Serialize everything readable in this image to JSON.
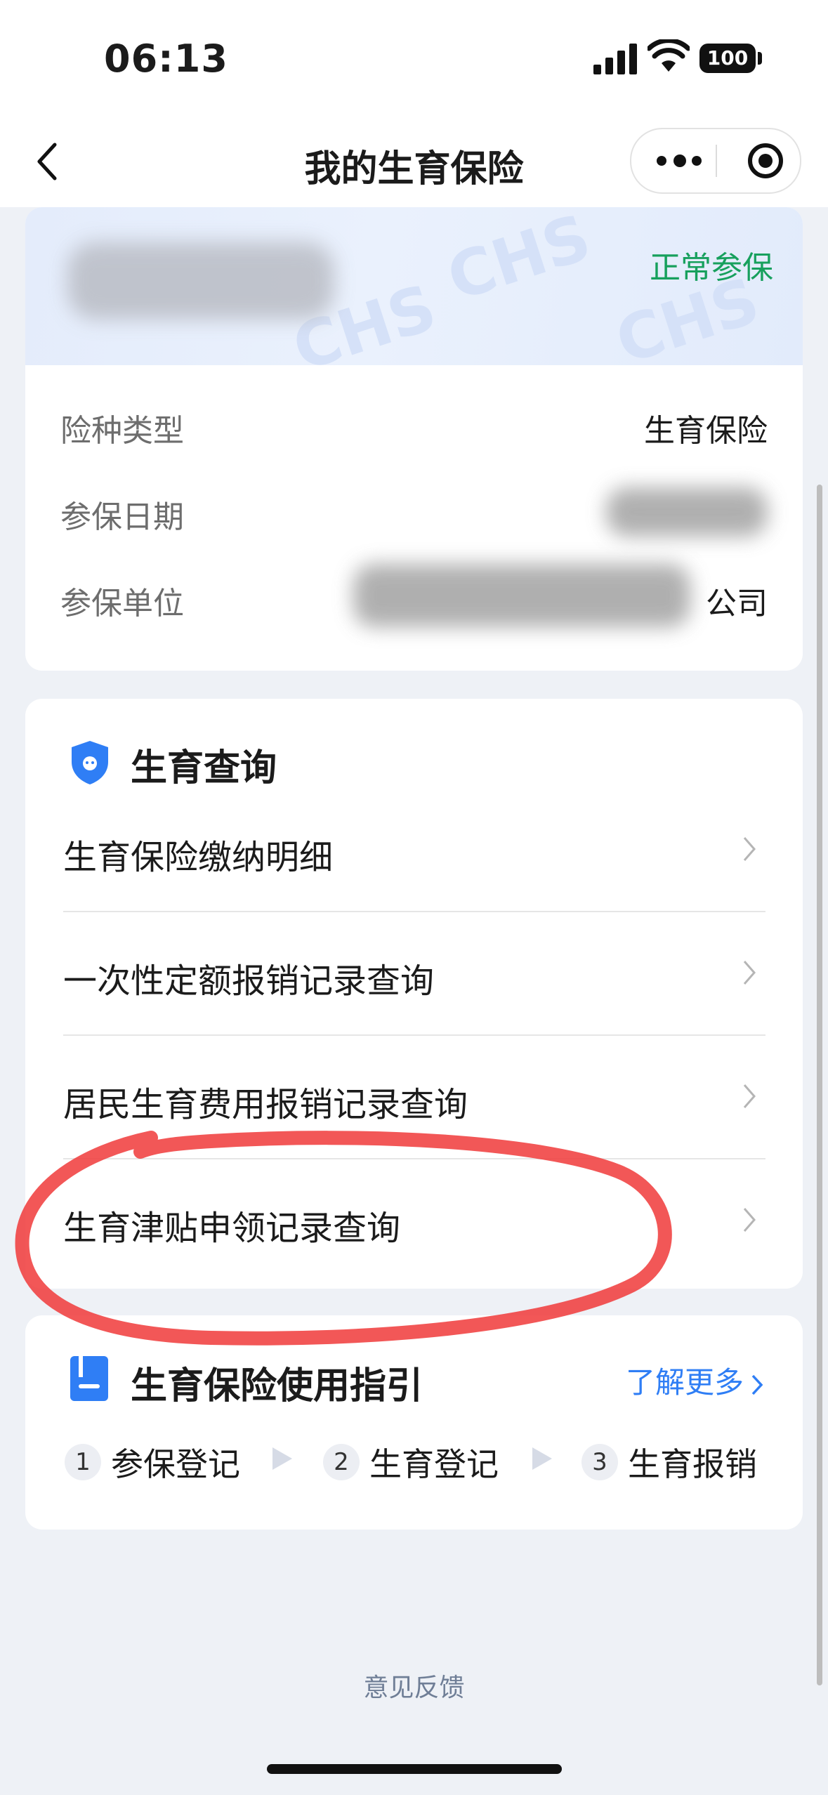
{
  "status_bar": {
    "time": "06:13",
    "battery": "100"
  },
  "nav": {
    "title": "我的生育保险"
  },
  "insurance_card": {
    "status": "正常参保",
    "rows": [
      {
        "label": "险种类型",
        "value": "生育保险"
      },
      {
        "label": "参保日期",
        "value": ""
      },
      {
        "label": "参保单位",
        "value": "公司"
      }
    ]
  },
  "query_section": {
    "title": "生育查询",
    "items": [
      {
        "label": "生育保险缴纳明细"
      },
      {
        "label": "一次性定额报销记录查询"
      },
      {
        "label": "居民生育费用报销记录查询"
      },
      {
        "label": "生育津贴申领记录查询"
      }
    ]
  },
  "guide_section": {
    "title": "生育保险使用指引",
    "learn_more": "了解更多",
    "steps": [
      {
        "num": "1",
        "label": "参保登记"
      },
      {
        "num": "2",
        "label": "生育登记"
      },
      {
        "num": "3",
        "label": "生育报销"
      }
    ]
  },
  "footer": {
    "feedback": "意见反馈"
  },
  "colors": {
    "status_green": "#17a05d",
    "link_blue": "#2f7ef5",
    "annotation_red": "#f03a3a"
  }
}
